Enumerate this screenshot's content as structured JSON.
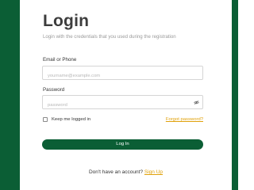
{
  "title": "Login",
  "subtitle": "Login with the credentials that you used during the registration",
  "email": {
    "label": "Email or Phone",
    "placeholder": "yourname@example.com",
    "value": ""
  },
  "password": {
    "label": "Password",
    "placeholder": "password",
    "value": "",
    "toggle_icon": "eye-icon"
  },
  "remember": {
    "label": "Keep me logged in",
    "checked": false
  },
  "forgot_label": "Forgot password?",
  "login_label": "Log In",
  "signup": {
    "prompt": "Don't have an account?",
    "link_label": "Sign Up"
  },
  "colors": {
    "brand_green": "#0b5e35",
    "link_orange": "#e0a10a"
  }
}
